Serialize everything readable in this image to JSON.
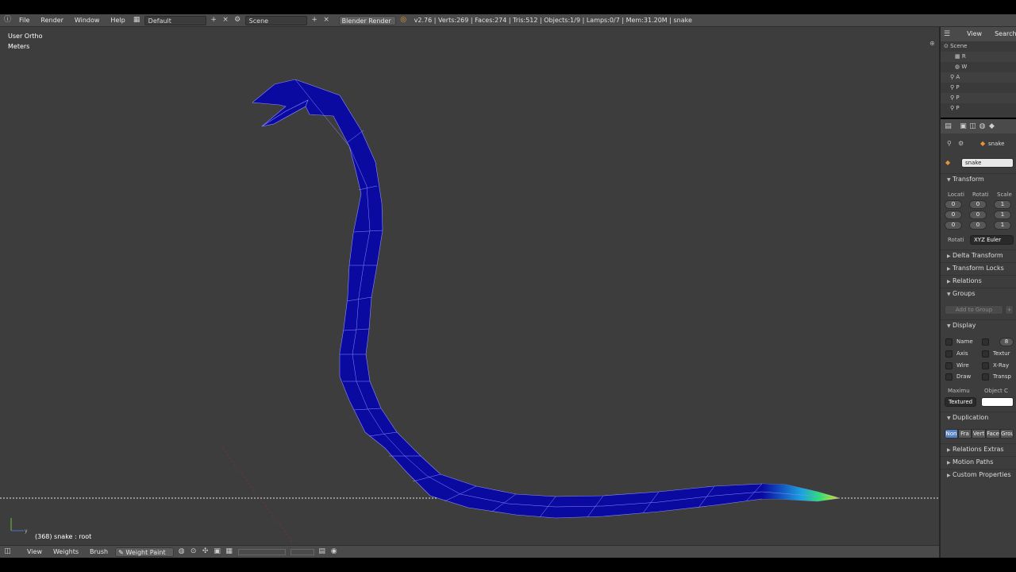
{
  "info_header": {
    "menus": [
      "File",
      "Render",
      "Window",
      "Help"
    ],
    "screen_layout": "Default",
    "scene": "Scene",
    "render_engine": "Blender Render",
    "stats": "v2.76 | Verts:269 | Faces:274 | Tris:512 | Objects:1/9 | Lamps:0/7 | Mem:31.20M | snake"
  },
  "viewport": {
    "view_name": "User Ortho",
    "units": "Meters",
    "status": "(368) snake : root"
  },
  "view3d_header": {
    "menus": [
      "View",
      "Weights",
      "Brush"
    ],
    "mode": "Weight Paint"
  },
  "outliner": {
    "menus": [
      "View",
      "Search"
    ],
    "rows": [
      "Scene",
      "R",
      "W",
      "A",
      "P",
      "P",
      "P"
    ]
  },
  "properties": {
    "breadcrumb": "snake",
    "object_name": "snake",
    "transform": {
      "title": "Transform",
      "location_label": "Locati",
      "rotation_label": "Rotati",
      "scale_label": "Scale",
      "location": [
        "0",
        "0",
        "0"
      ],
      "rotation": [
        "0",
        "0",
        "0"
      ],
      "scale": [
        "1",
        "1",
        "1"
      ],
      "rotation_mode_label": "Rotati",
      "rotation_mode": "XYZ Euler"
    },
    "collapsed_panels_1": [
      "Delta Transform",
      "Transform Locks",
      "Relations"
    ],
    "groups": {
      "title": "Groups",
      "add_button": "Add to Group"
    },
    "display": {
      "title": "Display",
      "checkboxes_left": [
        "Name",
        "Axis",
        "Wire",
        "Draw"
      ],
      "checkboxes_right": [
        "Textur",
        "X-Ray",
        "Transp"
      ],
      "max_draw_label": "Maximu",
      "object_color_label": "Object C",
      "draw_type": "Textured",
      "spin_value": "8"
    },
    "duplication": {
      "title": "Duplication",
      "options": [
        "Non",
        "Fra",
        "Vert",
        "Face",
        "Grou"
      ]
    },
    "collapsed_panels_2": [
      "Relations Extras",
      "Motion Paths",
      "Custom Properties"
    ]
  },
  "colors": {
    "viewport_bg": "#3d3d3d",
    "mesh_fill": "#0a0aa0",
    "wire": "#8b8bff",
    "accent": "#5680c2"
  }
}
